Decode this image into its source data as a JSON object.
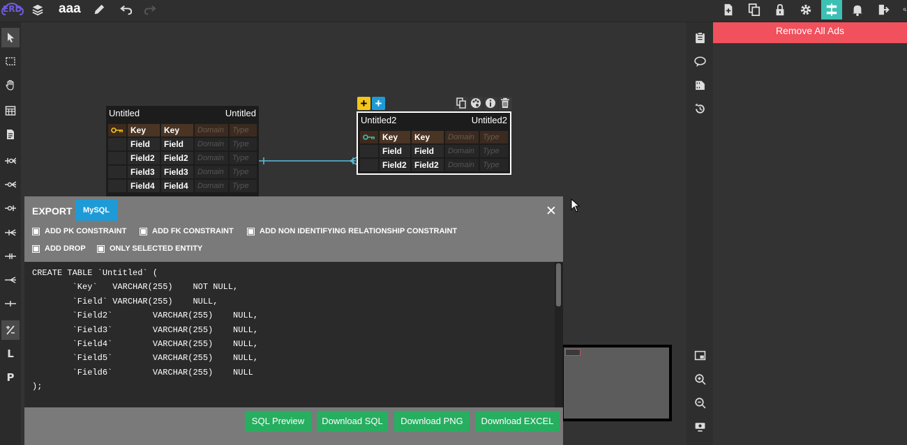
{
  "app": {
    "logo_text": "ERD",
    "doc_title": "aaa"
  },
  "ads": {
    "remove_label": "Remove All Ads"
  },
  "colors": {
    "accent_green": "#27ae60",
    "mysql_blue": "#1e9bd7",
    "ad_red": "#f0515d",
    "relation_line": "#5bc0de",
    "add_yellow": "#f5c518",
    "add_blue": "#1e9bd7"
  },
  "left_tools": {
    "text_tools": {
      "l_label": "L",
      "p_label": "P"
    }
  },
  "entities": [
    {
      "title_left": "Untitled",
      "title_right": "Untitled",
      "rows": [
        {
          "c1": "Key",
          "c2": "Key",
          "domain": "Domain",
          "type": "Type"
        },
        {
          "c1": "Field",
          "c2": "Field",
          "domain": "Domain",
          "type": "Type"
        },
        {
          "c1": "Field2",
          "c2": "Field2",
          "domain": "Domain",
          "type": "Type"
        },
        {
          "c1": "Field3",
          "c2": "Field3",
          "domain": "Domain",
          "type": "Type"
        },
        {
          "c1": "Field4",
          "c2": "Field4",
          "domain": "Domain",
          "type": "Type"
        }
      ]
    },
    {
      "title_left": "Untitled2",
      "title_right": "Untitled2",
      "rows": [
        {
          "c1": "Key",
          "c2": "Key",
          "domain": "Domain",
          "type": "Type"
        },
        {
          "c1": "Field",
          "c2": "Field",
          "domain": "Domain",
          "type": "Type"
        },
        {
          "c1": "Field2",
          "c2": "Field2",
          "domain": "Domain",
          "type": "Type"
        }
      ]
    }
  ],
  "export": {
    "title": "EXPORT",
    "tab": "MySQL",
    "close": "✕",
    "options": [
      "ADD PK CONSTRAINT",
      "ADD FK CONSTRAINT",
      "ADD NON IDENTIFYING RELATIONSHIP CONSTRAINT",
      "ADD DROP",
      "ONLY SELECTED ENTITY"
    ],
    "sql": "CREATE TABLE `Untitled` (\n        `Key`   VARCHAR(255)    NOT NULL,\n        `Field` VARCHAR(255)    NULL,\n        `Field2`        VARCHAR(255)    NULL,\n        `Field3`        VARCHAR(255)    NULL,\n        `Field4`        VARCHAR(255)    NULL,\n        `Field5`        VARCHAR(255)    NULL,\n        `Field6`        VARCHAR(255)    NULL\n);",
    "buttons": [
      "SQL Preview",
      "Download SQL",
      "Download PNG",
      "Download EXCEL"
    ]
  }
}
